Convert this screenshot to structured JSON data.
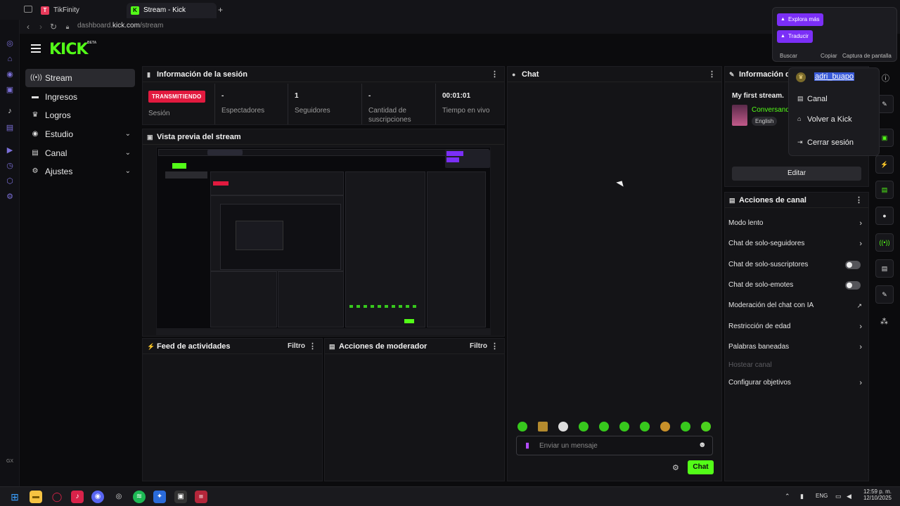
{
  "browser": {
    "tabs": [
      {
        "title": "TikFinity"
      },
      {
        "title": "Stream - Kick Dashboard"
      }
    ],
    "new_tab": "+",
    "url_prefix": "dashboard.",
    "url_domain": "kick.com",
    "url_path": "/stream"
  },
  "translator_popup": {
    "explore": "Explora más",
    "translate": "Traducir",
    "search": "Buscar",
    "copy": "Copiar",
    "screenshot": "Captura de pantalla"
  },
  "kick": {
    "logo": "KICK",
    "beta": "BETA"
  },
  "sidebar": {
    "items": [
      {
        "label": "Stream"
      },
      {
        "label": "Ingresos"
      },
      {
        "label": "Logros"
      },
      {
        "label": "Estudio"
      },
      {
        "label": "Canal"
      },
      {
        "label": "Ajustes"
      }
    ]
  },
  "session_info": {
    "title": "Información de la sesión",
    "badge": "TRANSMITIENDO",
    "session_label": "Sesión",
    "stats": [
      {
        "value": "-",
        "label": "Espectadores"
      },
      {
        "value": "1",
        "label": "Seguidores"
      },
      {
        "value": "-",
        "label": "Cantidad de suscripciones"
      },
      {
        "value": "00:01:01",
        "label": "Tiempo en vivo"
      }
    ]
  },
  "preview": {
    "title": "Vista previa del stream"
  },
  "activity_feed": {
    "title": "Feed de actividades",
    "filter": "Filtro"
  },
  "moderator_actions": {
    "title": "Acciones de moderador",
    "filter": "Filtro"
  },
  "chat": {
    "title": "Chat",
    "placeholder": "Enviar un mensaje",
    "send": "Chat"
  },
  "stream_info": {
    "title": "Información de",
    "stream_title": "My first stream.",
    "category": "Conversand",
    "language": "English",
    "edit": "Editar"
  },
  "user_menu": {
    "username": "adri_buapo",
    "items": [
      {
        "label": "Canal"
      },
      {
        "label": "Volver a Kick"
      },
      {
        "label": "Cerrar sesión"
      }
    ]
  },
  "channel_actions": {
    "title": "Acciones de canal",
    "rows": [
      {
        "label": "Modo lento",
        "control": "arrow"
      },
      {
        "label": "Chat de solo-seguidores",
        "control": "arrow"
      },
      {
        "label": "Chat de solo-suscriptores",
        "control": "toggle"
      },
      {
        "label": "Chat de solo-emotes",
        "control": "toggle"
      },
      {
        "label": "Moderación del chat con IA",
        "control": "external"
      },
      {
        "label": "Restricción de edad",
        "control": "arrow"
      },
      {
        "label": "Palabras baneadas",
        "control": "arrow"
      },
      {
        "label": "Hostear canal",
        "control": "none"
      },
      {
        "label": "Configurar objetivos",
        "control": "arrow"
      }
    ]
  },
  "taskbar": {
    "lang": "ENG",
    "time": "12:59 p. m.",
    "date": "12/10/2025"
  },
  "colors": {
    "accent": "#53fc18",
    "live": "#e21a3f",
    "panel": "#141417",
    "background": "#0b0b0d"
  }
}
